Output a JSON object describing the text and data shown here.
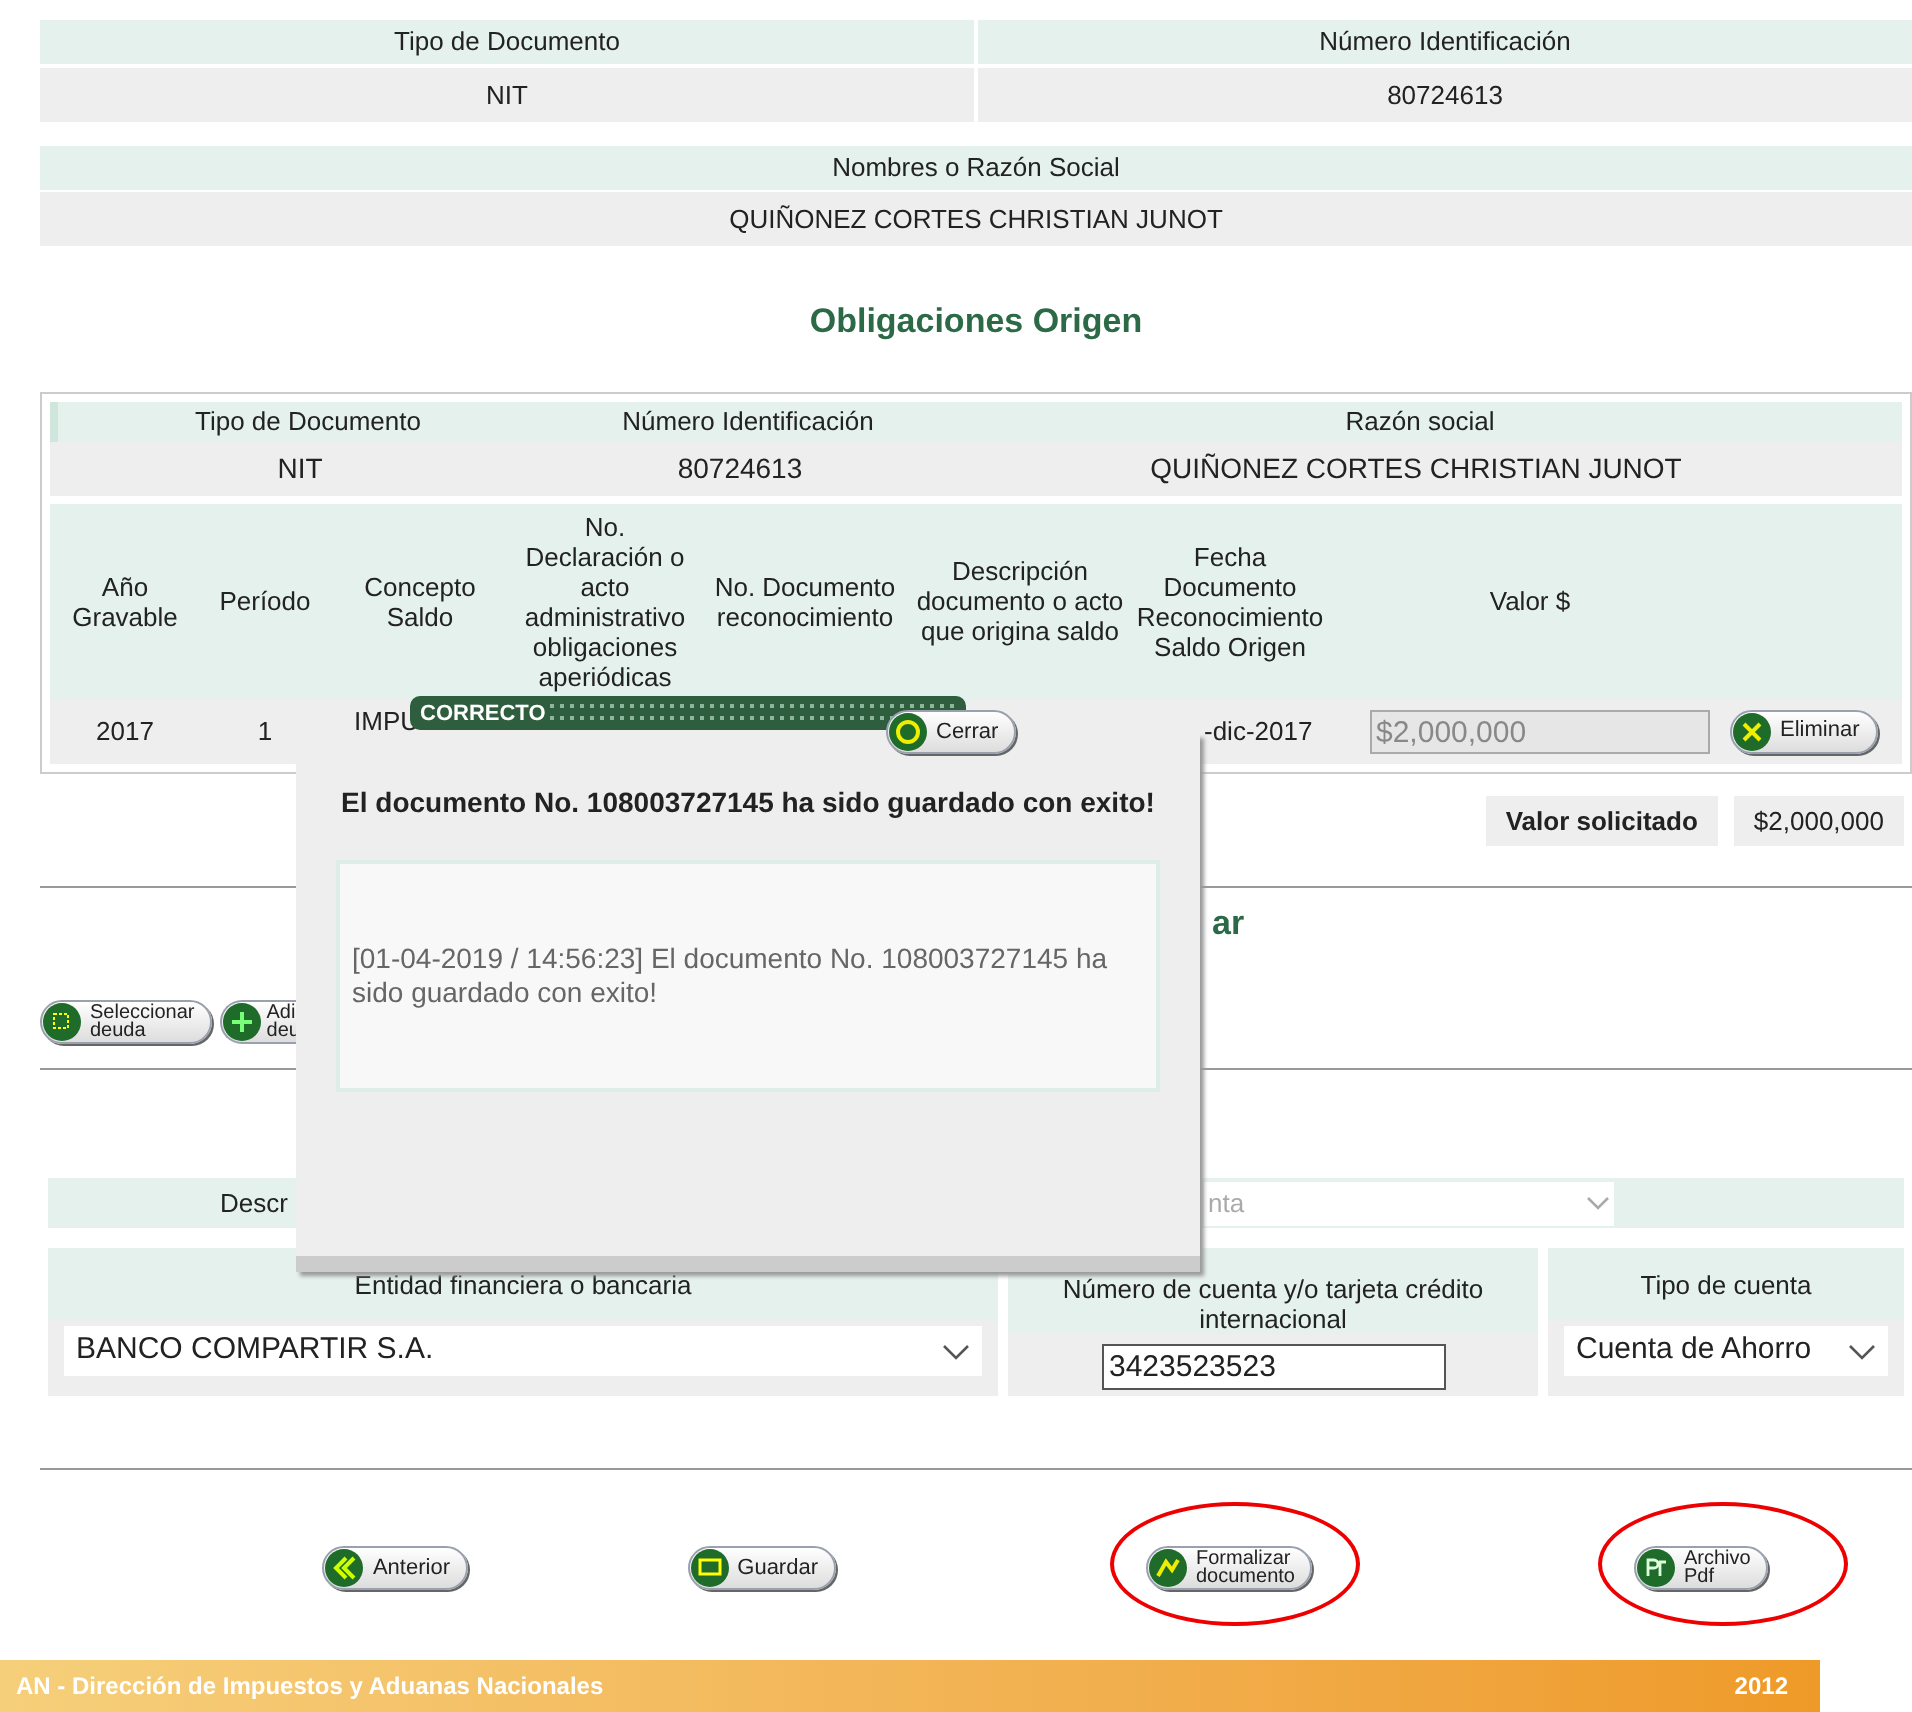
{
  "identity": {
    "headers": [
      "Tipo de Documento",
      "Número Identificación"
    ],
    "values": [
      "NIT",
      "80724613"
    ],
    "name_header": "Nombres o Razón Social",
    "name_value": "QUIÑONEZ CORTES CHRISTIAN JUNOT"
  },
  "origin": {
    "title": "Obligaciones Origen",
    "headers": [
      "Tipo de Documento",
      "Número Identificación",
      "Razón social"
    ],
    "values": [
      "NIT",
      "80724613",
      "QUIÑONEZ CORTES CHRISTIAN JUNOT"
    ],
    "columns": [
      "Año Gravable",
      "Período",
      "Concepto Saldo",
      "No. Declaración o acto administrativo obligaciones aperiódicas",
      "No. Documento reconocimiento",
      "Descripción documento o acto que origina saldo",
      "Fecha Documento Reconocimiento Saldo Origen",
      "Valor $"
    ],
    "row": {
      "year": "2017",
      "period": "1",
      "concept": "IMPU",
      "date": "-dic-2017",
      "value": "$2,000,000",
      "delete_button": "Eliminar"
    },
    "requested_label": "Valor solicitado",
    "requested_value": "$2,000,000"
  },
  "destination": {
    "title": "ar",
    "buttons": [
      {
        "kind": "select",
        "lines": [
          "Seleccionar",
          "deuda"
        ]
      },
      {
        "kind": "add",
        "lines": [
          "Adi",
          "deu"
        ]
      }
    ],
    "description_label": "Descr",
    "description_value": "nta"
  },
  "bank": {
    "entity_label": "Entidad financiera o bancaria",
    "entity_value": "BANCO COMPARTIR S.A.",
    "account_label": "Número de cuenta y/o tarjeta crédito internacional",
    "account_value": "3423523523",
    "type_label": "Tipo de cuenta",
    "type_value": "Cuenta de Ahorro"
  },
  "actions": [
    {
      "kind": "back",
      "lines": [
        "Anterior"
      ],
      "highlighted": false
    },
    {
      "kind": "save",
      "lines": [
        "Guardar"
      ],
      "highlighted": false
    },
    {
      "kind": "formalize",
      "lines": [
        "Formalizar",
        "documento"
      ],
      "highlighted": true
    },
    {
      "kind": "pdf",
      "lines": [
        "Archivo",
        "Pdf"
      ],
      "highlighted": true
    }
  ],
  "footer": {
    "text": "AN - Dirección de Impuestos y Aduanas Nacionales",
    "year": "2012"
  },
  "dialog": {
    "title": "CORRECTO",
    "close_button": "Cerrar",
    "message": "El documento No. 108003727145 ha sido guardado con exito!",
    "log": "[01-04-2019 / 14:56:23] El documento No. 108003727145 ha sido guardado con exito!"
  }
}
